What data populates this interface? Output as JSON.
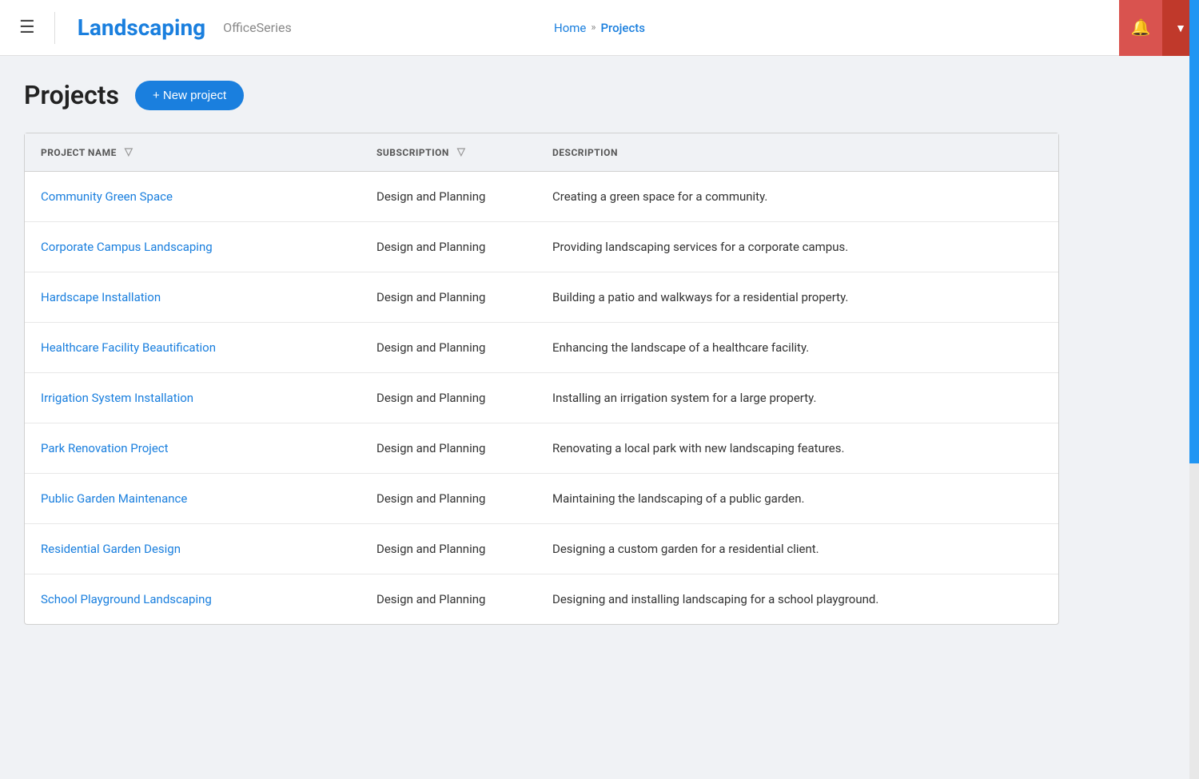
{
  "header": {
    "hamburger_label": "☰",
    "app_title": "Landscaping",
    "app_subtitle": "OfficeSeries",
    "nav_home": "Home",
    "nav_separator": "»",
    "nav_current": "Projects",
    "notif_icon": "🔔",
    "dropdown_icon": "▼"
  },
  "page": {
    "title": "Projects",
    "new_project_label": "+ New project"
  },
  "table": {
    "columns": [
      {
        "id": "project_name",
        "label": "PROJECT NAME",
        "has_filter": true
      },
      {
        "id": "subscription",
        "label": "SUBSCRIPTION",
        "has_filter": true
      },
      {
        "id": "description",
        "label": "DESCRIPTION",
        "has_filter": false
      }
    ],
    "rows": [
      {
        "project_name": "Community Green Space",
        "subscription": "Design and Planning",
        "description": "Creating a green space for a community."
      },
      {
        "project_name": "Corporate Campus Landscaping",
        "subscription": "Design and Planning",
        "description": "Providing landscaping services for a corporate campus."
      },
      {
        "project_name": "Hardscape Installation",
        "subscription": "Design and Planning",
        "description": "Building a patio and walkways for a residential property."
      },
      {
        "project_name": "Healthcare Facility Beautification",
        "subscription": "Design and Planning",
        "description": "Enhancing the landscape of a healthcare facility."
      },
      {
        "project_name": "Irrigation System Installation",
        "subscription": "Design and Planning",
        "description": "Installing an irrigation system for a large property."
      },
      {
        "project_name": "Park Renovation Project",
        "subscription": "Design and Planning",
        "description": "Renovating a local park with new landscaping features."
      },
      {
        "project_name": "Public Garden Maintenance",
        "subscription": "Design and Planning",
        "description": "Maintaining the landscaping of a public garden."
      },
      {
        "project_name": "Residential Garden Design",
        "subscription": "Design and Planning",
        "description": "Designing a custom garden for a residential client."
      },
      {
        "project_name": "School Playground Landscaping",
        "subscription": "Design and Planning",
        "description": "Designing and installing landscaping for a school playground."
      }
    ]
  }
}
